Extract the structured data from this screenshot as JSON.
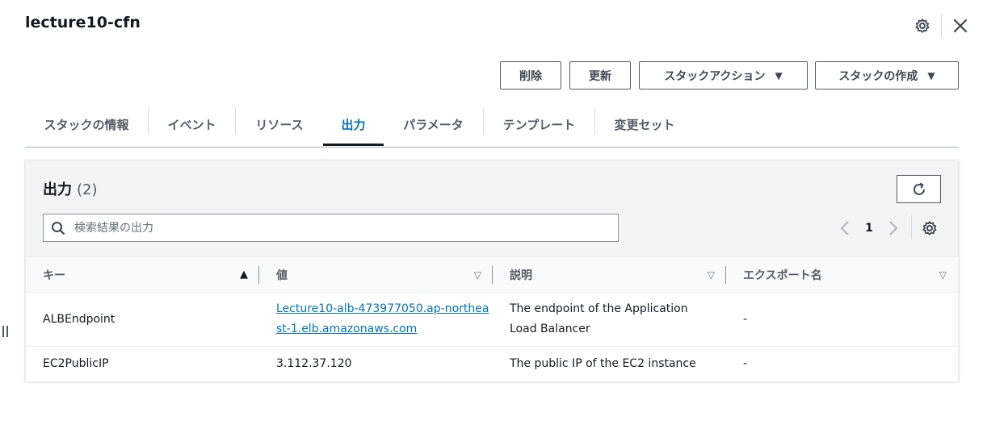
{
  "header": {
    "title": "lecture10-cfn",
    "settings_icon": "gear-icon",
    "close_icon": "close-icon"
  },
  "actions": {
    "delete_label": "削除",
    "update_label": "更新",
    "stack_actions_label": "スタックアクション",
    "create_stack_label": "スタックの作成"
  },
  "tabs": [
    {
      "label": "スタックの情報"
    },
    {
      "label": "イベント"
    },
    {
      "label": "リソース"
    },
    {
      "label": "出力"
    },
    {
      "label": "パラメータ"
    },
    {
      "label": "テンプレート"
    },
    {
      "label": "変更セット"
    }
  ],
  "active_tab": "出力",
  "outputs": {
    "title": "出力",
    "count": "(2)",
    "search_placeholder": "検索結果の出力",
    "page": "1",
    "columns": [
      {
        "label": "キー"
      },
      {
        "label": "値"
      },
      {
        "label": "説明"
      },
      {
        "label": "エクスポート名"
      }
    ],
    "rows": [
      {
        "key": "ALBEndpoint",
        "value": "Lecture10-alb-473977050.ap-northeast-1.elb.amazonaws.com",
        "description": "The endpoint of the Application Load Balancer",
        "export": "-"
      },
      {
        "key": "EC2PublicIP",
        "value": "3.112.37.120",
        "description": "The public IP of the EC2 instance",
        "export": "-"
      }
    ]
  },
  "colors": {
    "accent": "#0073bb",
    "text": "#16191f",
    "muted": "#545b64"
  }
}
